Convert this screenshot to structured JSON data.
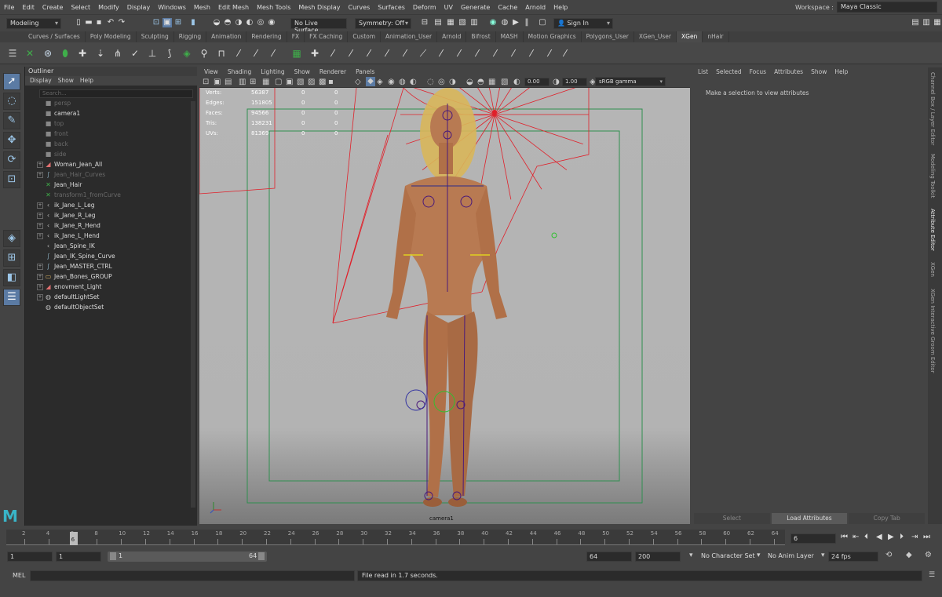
{
  "menubar": [
    "File",
    "Edit",
    "Create",
    "Select",
    "Modify",
    "Display",
    "Windows",
    "Mesh",
    "Edit Mesh",
    "Mesh Tools",
    "Mesh Display",
    "Curves",
    "Surfaces",
    "Deform",
    "UV",
    "Generate",
    "Cache",
    "Arnold",
    "Help"
  ],
  "workspace": {
    "label": "Workspace :",
    "value": "Maya Classic"
  },
  "status": {
    "menuset": "Modeling",
    "live_surface": "No Live Surface",
    "symmetry": "Symmetry: Off",
    "sign_in": "Sign In"
  },
  "shelf_tabs": [
    "Curves / Surfaces",
    "Poly Modeling",
    "Sculpting",
    "Rigging",
    "Animation",
    "Rendering",
    "FX",
    "FX Caching",
    "Custom",
    "Animation_User",
    "Arnold",
    "Bifrost",
    "MASH",
    "Motion Graphics",
    "Polygons_User",
    "XGen_User",
    "XGen",
    "nHair"
  ],
  "active_shelf_tab": "XGen",
  "outliner": {
    "title": "Outliner",
    "menu": [
      "Display",
      "Show",
      "Help"
    ],
    "search_placeholder": "Search...",
    "items": [
      {
        "label": "persp",
        "icon": "camera-icon",
        "dim": true,
        "expand": false
      },
      {
        "label": "camera1",
        "icon": "camera-icon",
        "dim": false,
        "expand": false
      },
      {
        "label": "top",
        "icon": "camera-icon",
        "dim": true,
        "expand": false
      },
      {
        "label": "front",
        "icon": "camera-icon",
        "dim": true,
        "expand": false
      },
      {
        "label": "back",
        "icon": "camera-icon",
        "dim": true,
        "expand": false
      },
      {
        "label": "side",
        "icon": "camera-icon",
        "dim": true,
        "expand": false
      },
      {
        "label": "Woman_Jean_All",
        "icon": "mesh-icon",
        "dim": false,
        "expand": true
      },
      {
        "label": "Jean_Hair_Curves",
        "icon": "curve-icon",
        "dim": true,
        "expand": true
      },
      {
        "label": "Jean_Hair",
        "icon": "xgen-icon",
        "dim": false,
        "expand": false
      },
      {
        "label": "transform1_fromCurve",
        "icon": "xgen-icon",
        "dim": true,
        "expand": false
      },
      {
        "label": "ik_Jane_L_Leg",
        "icon": "ik-icon",
        "dim": false,
        "expand": true
      },
      {
        "label": "ik_Jane_R_Leg",
        "icon": "ik-icon",
        "dim": false,
        "expand": true
      },
      {
        "label": "ik_Jane_R_Hend",
        "icon": "ik-icon",
        "dim": false,
        "expand": true
      },
      {
        "label": "ik_Jane_L_Hend",
        "icon": "ik-icon",
        "dim": false,
        "expand": true
      },
      {
        "label": "Jean_Spine_IK",
        "icon": "ik-icon",
        "dim": false,
        "expand": false
      },
      {
        "label": "Jean_IK_Spine_Curve",
        "icon": "curve-icon",
        "dim": false,
        "expand": false
      },
      {
        "label": "Jean_MASTER_CTRL",
        "icon": "curve-icon",
        "dim": false,
        "expand": true
      },
      {
        "label": "Jean_Bones_GROUP",
        "icon": "group-icon",
        "dim": false,
        "expand": true
      },
      {
        "label": "enovment_Light",
        "icon": "mesh-icon",
        "dim": false,
        "expand": true
      },
      {
        "label": "defaultLightSet",
        "icon": "set-icon",
        "dim": false,
        "expand": true
      },
      {
        "label": "defaultObjectSet",
        "icon": "set-icon",
        "dim": false,
        "expand": false
      }
    ]
  },
  "viewport": {
    "menu": [
      "View",
      "Shading",
      "Lighting",
      "Show",
      "Renderer",
      "Panels"
    ],
    "exposure": "0.00",
    "gamma": "1.00",
    "colorspace": "sRGB gamma",
    "camera_label": "camera1",
    "hud": [
      {
        "label": "Verts:",
        "a": "56387",
        "b": "0",
        "c": "0"
      },
      {
        "label": "Edges:",
        "a": "151805",
        "b": "0",
        "c": "0"
      },
      {
        "label": "Faces:",
        "a": "94566",
        "b": "0",
        "c": "0"
      },
      {
        "label": "Tris:",
        "a": "138231",
        "b": "0",
        "c": "0"
      },
      {
        "label": "UVs:",
        "a": "81369",
        "b": "0",
        "c": "0"
      }
    ]
  },
  "attribute_editor": {
    "menu": [
      "List",
      "Selected",
      "Focus",
      "Attributes",
      "Show",
      "Help"
    ],
    "message": "Make a selection to view attributes",
    "buttons": [
      "Select",
      "Load Attributes",
      "Copy Tab"
    ],
    "side_tabs": [
      "Channel Box / Layer Editor",
      "Modeling Toolkit",
      "Attribute Editor",
      "XGen",
      "XGen Interactive Groom Editor"
    ]
  },
  "timeline": {
    "ticks": [
      "2",
      "4",
      "6",
      "8",
      "10",
      "12",
      "14",
      "16",
      "18",
      "20",
      "22",
      "24",
      "26",
      "28",
      "30",
      "32",
      "34",
      "36",
      "38",
      "40",
      "42",
      "44",
      "46",
      "48",
      "50",
      "52",
      "54",
      "56",
      "58",
      "60",
      "62",
      "64"
    ],
    "current": "6",
    "current_field": "6"
  },
  "range": {
    "start": "1",
    "start2": "1",
    "slider_start": "1",
    "slider_end": "64",
    "end": "64",
    "end2": "200",
    "character_set": "No Character Set",
    "anim_layer": "No Anim Layer",
    "fps": "24 fps"
  },
  "command": {
    "lang": "MEL",
    "feedback": "File read in  1.7 seconds."
  },
  "colors": {
    "accent": "#5b7ba4",
    "rig_red": "#e0202a",
    "frame_green": "#2f8f4f",
    "skin": "#b87a52"
  }
}
